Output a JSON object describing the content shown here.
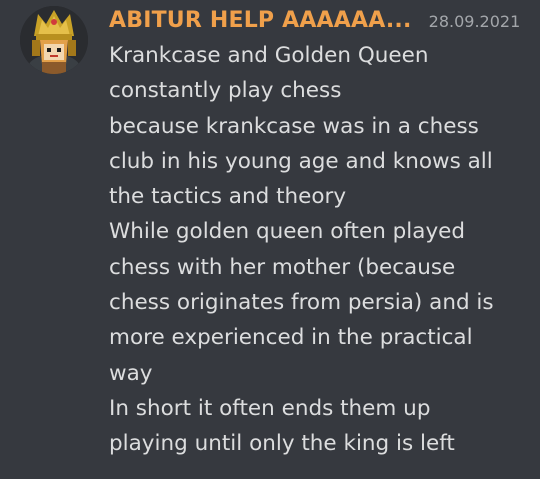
{
  "message": {
    "username": "ABITUR HELP AAAAAA...",
    "timestamp": "28.09.2021",
    "lines": [
      "Krankcase and Golden Queen",
      "constantly play chess",
      "because krankcase was in a chess",
      "club in his young age and knows all",
      "the tactics and theory",
      "While golden queen often played",
      "chess with her mother (because",
      "chess originates from persia) and is",
      "more experienced in the practical",
      "way",
      "In short it often ends them up",
      "playing until only the king is left"
    ]
  },
  "colors": {
    "background": "#36393f",
    "username": "#f0a04b",
    "text": "#dcddde",
    "timestamp": "#a3a6aa"
  },
  "icons": {
    "avatar": "golden-queen-avatar-icon"
  }
}
